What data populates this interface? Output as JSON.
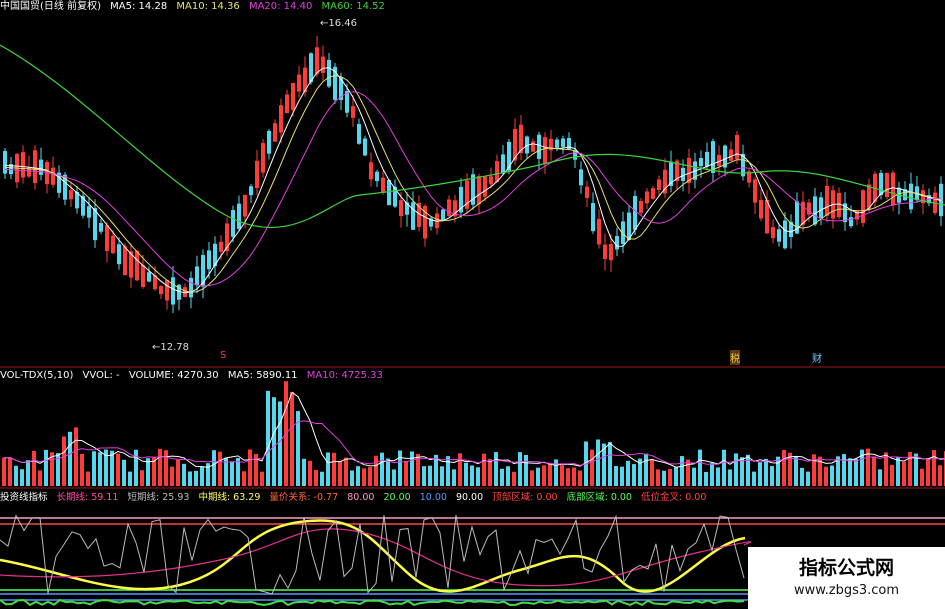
{
  "price_header": {
    "title": "中国国贸(日线 前复权)",
    "ma5": "MA5: 14.28",
    "ma10": "MA10: 14.36",
    "ma20": "MA20: 14.40",
    "ma60": "MA60: 14.52"
  },
  "price_annotations": {
    "high": "16.46",
    "low": "12.78"
  },
  "event_markers": [
    "S",
    "税",
    "财"
  ],
  "volume_header": {
    "title": "VOL-TDX(5,10)",
    "vol": "VVOL: -",
    "volume": "VOLUME: 4270.30",
    "ma5": "MA5: 5890.11",
    "ma10": "MA10: 4725.33"
  },
  "indicator_header": {
    "title": "投资线指标",
    "long": "长期线: 59.11",
    "short": "短期线: 25.93",
    "mid": "中期线: 63.29",
    "pricevol": "量价关系: -0.77",
    "l80": "80.00",
    "l20": "20.00",
    "l10": "10.00",
    "l90": "90.00",
    "top": "顶部区域: 0.00",
    "bottom": "底部区域: 0.00",
    "cross": "低位金叉: 0.00"
  },
  "watermark": {
    "title": "指标公式网",
    "url": "www.zbgs3.com"
  },
  "colors": {
    "up": "#ff3b3b",
    "down": "#54d8f0",
    "ma5": "#ffffff",
    "ma10": "#e9e26a",
    "ma20": "#e040e0",
    "ma60": "#3fd03f",
    "divider": "#a01818"
  }
}
